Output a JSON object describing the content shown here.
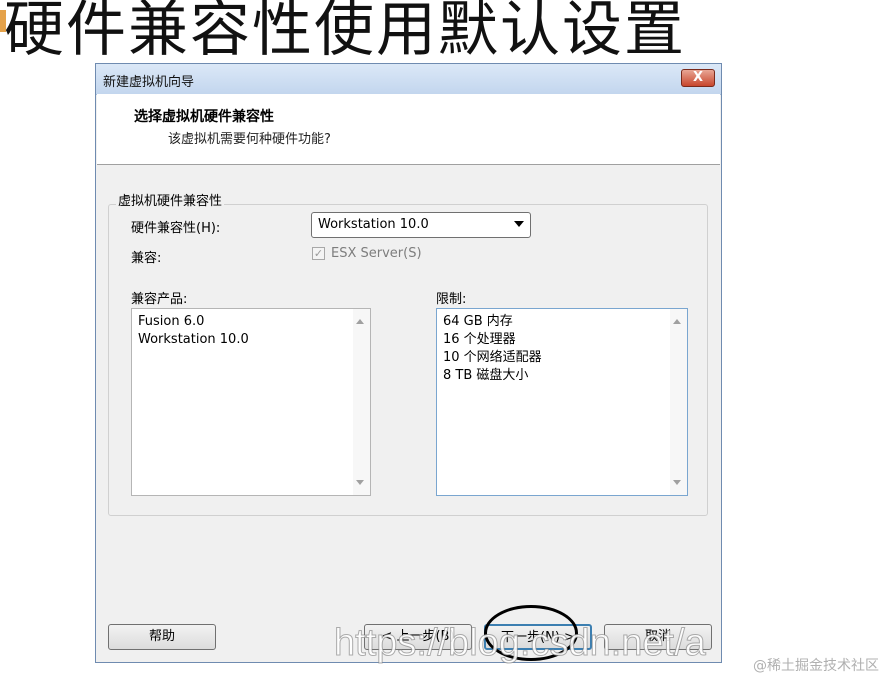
{
  "headline": "硬件兼容性使用默认设置",
  "dialog": {
    "title": "新建虚拟机向导",
    "close_label": "X",
    "step_title": "选择虚拟机硬件兼容性",
    "step_subtitle": "该虚拟机需要何种硬件功能?",
    "group_label": "虚拟机硬件兼容性",
    "hw_compat_label": "硬件兼容性(H):",
    "hw_compat_value": "Workstation 10.0",
    "compat_label": "兼容:",
    "esx_label": "ESX Server(S)",
    "esx_checked": true,
    "products_label": "兼容产品:",
    "products": [
      "Fusion 6.0",
      "Workstation 10.0"
    ],
    "limits_label": "限制:",
    "limits": [
      "64 GB 内存",
      "16 个处理器",
      "10 个网络适配器",
      "8 TB 磁盘大小"
    ],
    "buttons": {
      "help": "帮助",
      "back": "< 上一步(B)",
      "next": "下一步(N) >",
      "cancel": "取消"
    }
  },
  "watermark": {
    "url": "https://blog.csdn.net/a",
    "brand": "@稀土掘金技术社区"
  }
}
